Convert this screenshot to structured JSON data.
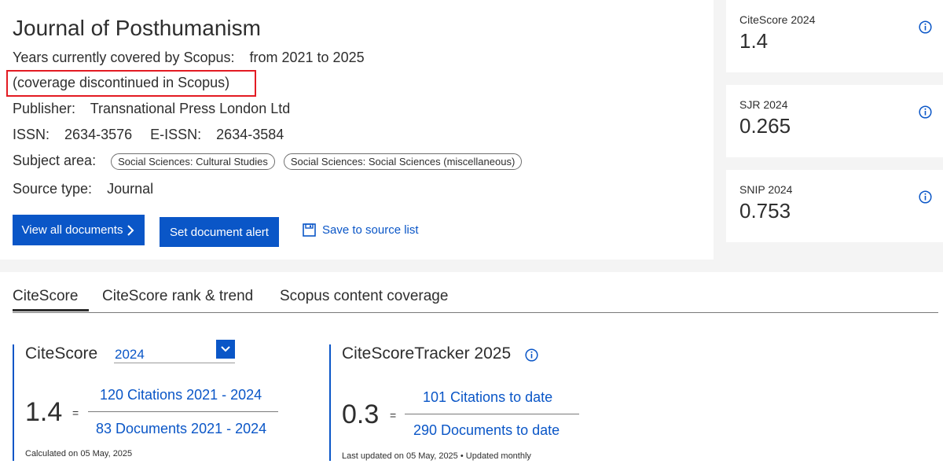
{
  "journal": {
    "title": "Journal of Posthumanism",
    "years_label": "Years currently covered by Scopus:",
    "years_value": "from 2021 to 2025",
    "coverage_note": "(coverage discontinued in Scopus)",
    "publisher_label": "Publisher:",
    "publisher_value": "Transnational Press London Ltd",
    "issn_label": "ISSN:",
    "issn_value": "2634-3576",
    "eissn_label": "E-ISSN:",
    "eissn_value": "2634-3584",
    "subject_label": "Subject area:",
    "subjects": [
      "Social Sciences: Cultural Studies",
      "Social Sciences: Social Sciences (miscellaneous)"
    ],
    "source_type_label": "Source type:",
    "source_type_value": "Journal"
  },
  "actions": {
    "view_all": "View all documents",
    "set_alert": "Set document alert",
    "save_to_list": "Save to source list"
  },
  "metrics": [
    {
      "label": "CiteScore 2024",
      "value": "1.4"
    },
    {
      "label": "SJR 2024",
      "value": "0.265"
    },
    {
      "label": "SNIP 2024",
      "value": "0.753"
    }
  ],
  "tabs": [
    "CiteScore",
    "CiteScore rank & trend",
    "Scopus content coverage"
  ],
  "citescore": {
    "title": "CiteScore",
    "year_selected": "2024",
    "value": "1.4",
    "equals": "=",
    "numerator": "120 Citations 2021 - 2024",
    "denominator": "83 Documents 2021 - 2024",
    "note": "Calculated on 05 May, 2025"
  },
  "tracker": {
    "title": "CiteScoreTracker 2025",
    "value": "0.3",
    "equals": "=",
    "numerator": "101 Citations to date",
    "denominator": "290 Documents to date",
    "note": "Last updated on 05 May, 2025 • Updated monthly"
  },
  "colors": {
    "accent": "#0a56c7",
    "highlight": "#e31b23",
    "panel_bg": "#f4f4f4"
  }
}
